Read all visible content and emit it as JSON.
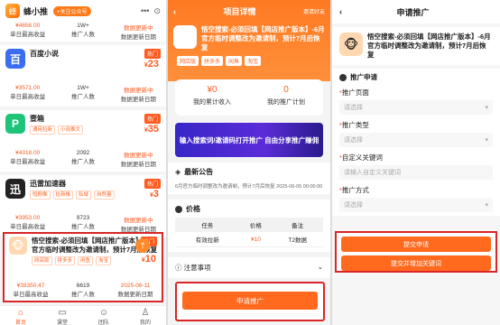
{
  "panel1": {
    "app_name": "蜂小推",
    "follow_label": "+关注公众号",
    "top_stats": [
      {
        "value": "¥4656.00",
        "label": "单日最高收益"
      },
      {
        "value": "1W+",
        "label": "推广人数"
      },
      {
        "value": "数据更新中",
        "label": "数据更新日期"
      }
    ],
    "cards": [
      {
        "title": "百度小说",
        "icon": "百",
        "color": "#3a6df0",
        "hot": "热门",
        "price": "23",
        "stats": [
          {
            "value": "¥3571.00",
            "label": "单日最高收益"
          },
          {
            "value": "1W+",
            "label": "推广人数"
          },
          {
            "value": "数据更新中",
            "label": "数据更新日期"
          }
        ]
      },
      {
        "title": "壹箱",
        "icon": "P",
        "color": "#1ec47a",
        "hot": "热门",
        "price": "35",
        "tags": [
          "通用拉新",
          "小说推文"
        ],
        "stats": [
          {
            "value": "¥4318.00",
            "label": "单日最高收益"
          },
          {
            "value": "2092",
            "label": "推广人数"
          },
          {
            "value": "数据更新中",
            "label": "数据更新日期"
          }
        ]
      },
      {
        "title": "迅雷加速器",
        "icon": "迅",
        "color": "#222222",
        "hot": "热门",
        "price": "3",
        "tags": [
          "短剧推",
          "拉新推",
          "私域",
          "自然量"
        ],
        "stats": [
          {
            "value": "¥3953.00",
            "label": "单日最高收益"
          },
          {
            "value": "9723",
            "label": "推广人数"
          },
          {
            "value": "数据更新中",
            "label": "数据更新日期"
          }
        ]
      }
    ],
    "highlight": {
      "title": "悟空搜索-必须回填【网店推广版本】-6月官方临时调整改为邀请制，预计7月后恢复",
      "hot": "热门",
      "price": "10",
      "tags": [
        "网店版",
        "拼多多",
        "闲鱼",
        "淘宝"
      ],
      "stats": [
        {
          "value": "¥39350.47",
          "label": "单日最高收益"
        },
        {
          "value": "6619",
          "label": "推广人数"
        },
        {
          "value": "2025-06-11",
          "label": "数据更新日期"
        }
      ]
    },
    "tabs": [
      {
        "icon": "⌂",
        "label": "首页"
      },
      {
        "icon": "▭",
        "label": "课堂"
      },
      {
        "icon": "☺",
        "label": "团队"
      },
      {
        "icon": "♙",
        "label": "我的"
      }
    ]
  },
  "panel2": {
    "title": "项目详情",
    "share_label": "邀请好友",
    "product_title": "悟空搜索-必须回填【网店推广版本】-6月官方临时调整改为邀请制，预计7月后恢复",
    "tags": [
      "网店版",
      "拼多多",
      "闲鱼",
      "淘宝"
    ],
    "income": {
      "value": "¥0",
      "label": "我的累计收入"
    },
    "plan": {
      "value": "0",
      "label": "我的推广计划"
    },
    "banner_text": "输入搜索词/邀请码打开推广 自由分享推广赚佣",
    "notice_title": "最新公告",
    "notice_body": "6月官方临时调整改为邀请制，预计7月后恢复 2025-06-05 00:00:00",
    "price_title": "价格",
    "table": {
      "headers": [
        "任务",
        "价格",
        "备注"
      ],
      "rows": [
        [
          "有效拉新",
          "¥10",
          "T2数据"
        ]
      ]
    },
    "notes_title": "注意事项",
    "apply_label": "申请推广"
  },
  "panel3": {
    "title": "申请推广",
    "product_title": "悟空搜索-必须回填【网店推广版本】-6月官方临时调整改为邀请制，预计7月后恢复",
    "section": "推广申请",
    "fields": [
      {
        "label": "推广页面",
        "placeholder": "请选择"
      },
      {
        "label": "推广类型",
        "placeholder": "请选择"
      },
      {
        "label": "自定义关键词",
        "placeholder": "请输入自定义关键词"
      },
      {
        "label": "推广方式",
        "placeholder": "请选择"
      }
    ],
    "submit_label": "提交申请",
    "submit_more_label": "提交并增加关键词"
  }
}
